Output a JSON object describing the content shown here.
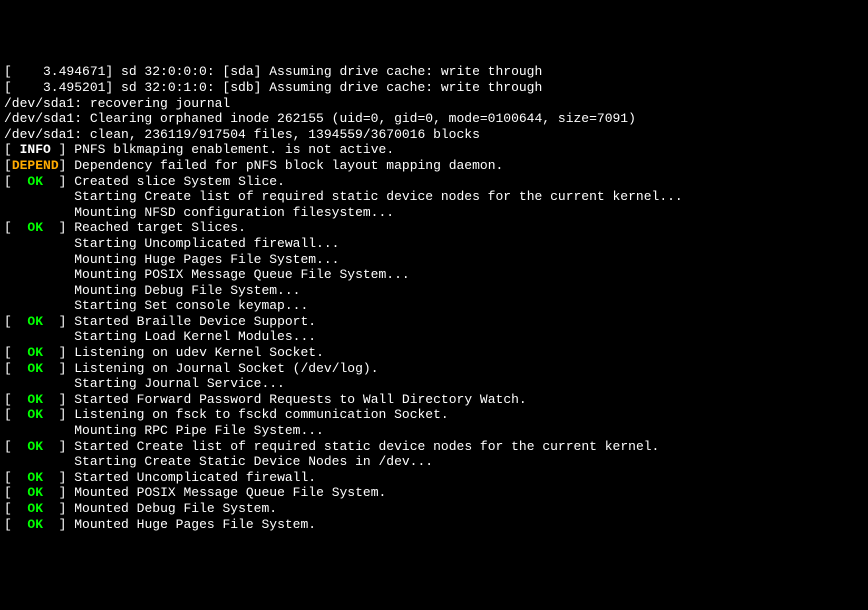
{
  "lines": [
    {
      "type": "plain",
      "text": "[    3.494671] sd 32:0:0:0: [sda] Assuming drive cache: write through"
    },
    {
      "type": "plain",
      "text": "[    3.495201] sd 32:0:1:0: [sdb] Assuming drive cache: write through"
    },
    {
      "type": "plain",
      "text": "/dev/sda1: recovering journal"
    },
    {
      "type": "plain",
      "text": "/dev/sda1: Clearing orphaned inode 262155 (uid=0, gid=0, mode=0100644, size=7091)"
    },
    {
      "type": "plain",
      "text": "/dev/sda1: clean, 236119/917504 files, 1394559/3670016 blocks"
    },
    {
      "type": "status",
      "status": "INFO",
      "pad_left": " ",
      "pad_right": " ",
      "text": "PNFS blkmaping enablement. is not active."
    },
    {
      "type": "status",
      "status": "DEPEND",
      "pad_left": "",
      "pad_right": "",
      "text": "Dependency failed for pNFS block layout mapping daemon."
    },
    {
      "type": "status",
      "status": "OK",
      "pad_left": "  ",
      "pad_right": "  ",
      "text": "Created slice System Slice."
    },
    {
      "type": "indent",
      "text": "Starting Create list of required static device nodes for the current kernel..."
    },
    {
      "type": "indent",
      "text": "Mounting NFSD configuration filesystem..."
    },
    {
      "type": "status",
      "status": "OK",
      "pad_left": "  ",
      "pad_right": "  ",
      "text": "Reached target Slices."
    },
    {
      "type": "indent",
      "text": "Starting Uncomplicated firewall..."
    },
    {
      "type": "indent",
      "text": "Mounting Huge Pages File System..."
    },
    {
      "type": "indent",
      "text": "Mounting POSIX Message Queue File System..."
    },
    {
      "type": "indent",
      "text": "Mounting Debug File System..."
    },
    {
      "type": "indent",
      "text": "Starting Set console keymap..."
    },
    {
      "type": "status",
      "status": "OK",
      "pad_left": "  ",
      "pad_right": "  ",
      "text": "Started Braille Device Support."
    },
    {
      "type": "indent",
      "text": "Starting Load Kernel Modules..."
    },
    {
      "type": "status",
      "status": "OK",
      "pad_left": "  ",
      "pad_right": "  ",
      "text": "Listening on udev Kernel Socket."
    },
    {
      "type": "status",
      "status": "OK",
      "pad_left": "  ",
      "pad_right": "  ",
      "text": "Listening on Journal Socket (/dev/log)."
    },
    {
      "type": "indent",
      "text": "Starting Journal Service..."
    },
    {
      "type": "status",
      "status": "OK",
      "pad_left": "  ",
      "pad_right": "  ",
      "text": "Started Forward Password Requests to Wall Directory Watch."
    },
    {
      "type": "status",
      "status": "OK",
      "pad_left": "  ",
      "pad_right": "  ",
      "text": "Listening on fsck to fsckd communication Socket."
    },
    {
      "type": "indent",
      "text": "Mounting RPC Pipe File System..."
    },
    {
      "type": "status",
      "status": "OK",
      "pad_left": "  ",
      "pad_right": "  ",
      "text": "Started Create list of required static device nodes for the current kernel."
    },
    {
      "type": "indent",
      "text": "Starting Create Static Device Nodes in /dev..."
    },
    {
      "type": "status",
      "status": "OK",
      "pad_left": "  ",
      "pad_right": "  ",
      "text": "Started Uncomplicated firewall."
    },
    {
      "type": "status",
      "status": "OK",
      "pad_left": "  ",
      "pad_right": "  ",
      "text": "Mounted POSIX Message Queue File System."
    },
    {
      "type": "status",
      "status": "OK",
      "pad_left": "  ",
      "pad_right": "  ",
      "text": "Mounted Debug File System."
    },
    {
      "type": "status",
      "status": "OK",
      "pad_left": "  ",
      "pad_right": "  ",
      "text": "Mounted Huge Pages File System."
    }
  ],
  "indent_spaces": "         ",
  "status_classes": {
    "OK": "status-ok",
    "INFO": "status-info",
    "DEPEND": "status-depend"
  }
}
